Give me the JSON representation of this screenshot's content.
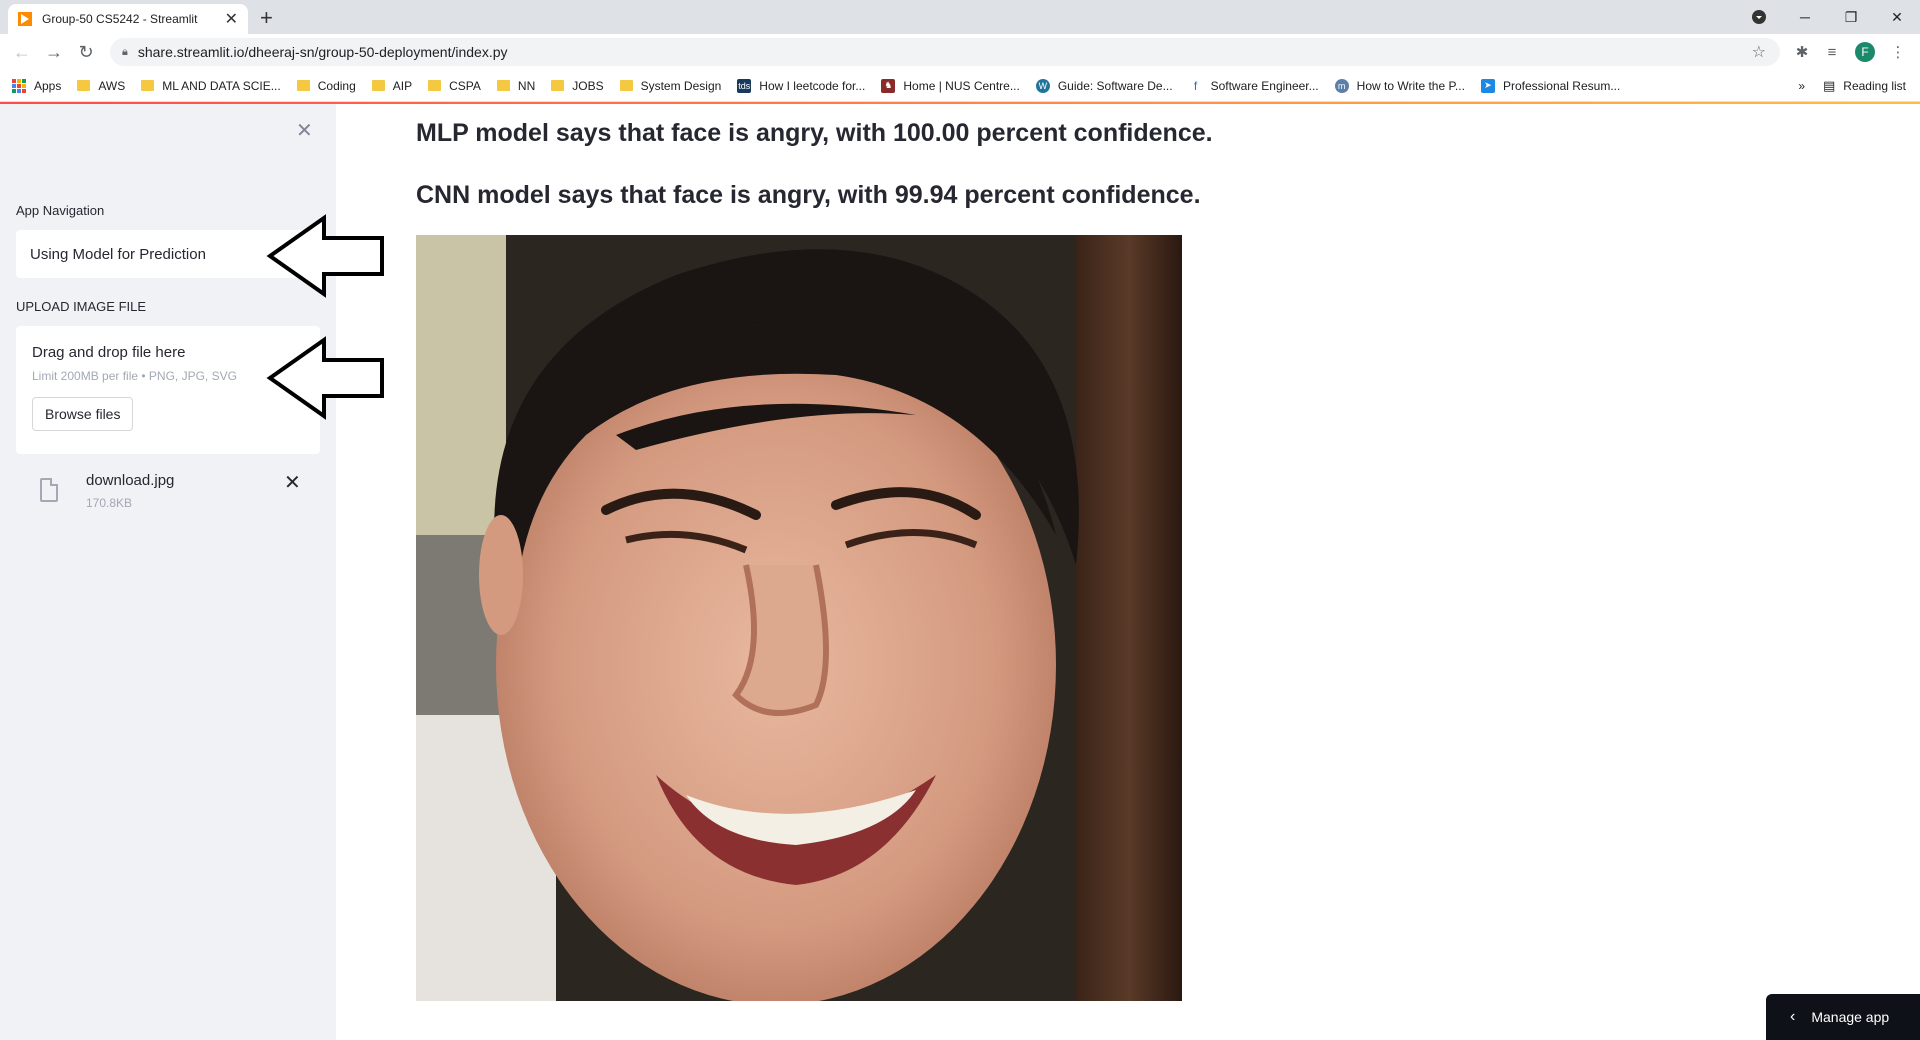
{
  "browser": {
    "tab_title": "Group-50 CS5242 - Streamlit",
    "tab_close": "✕",
    "new_tab": "+",
    "url": "share.streamlit.io/dheeraj-sn/group-50-deployment/index.py",
    "profile_initial": "F"
  },
  "bookmarks": {
    "items": [
      {
        "label": "Apps",
        "icon": "apps-grid-icon"
      },
      {
        "label": "AWS",
        "icon": "folder-icon"
      },
      {
        "label": "ML AND DATA SCIE...",
        "icon": "folder-icon"
      },
      {
        "label": "Coding",
        "icon": "folder-icon"
      },
      {
        "label": "AIP",
        "icon": "folder-icon"
      },
      {
        "label": "CSPA",
        "icon": "folder-icon"
      },
      {
        "label": "NN",
        "icon": "folder-icon"
      },
      {
        "label": "JOBS",
        "icon": "folder-icon"
      },
      {
        "label": "System Design",
        "icon": "folder-icon"
      },
      {
        "label": "How I leetcode for...",
        "icon": "site-icon"
      },
      {
        "label": "Home | NUS Centre...",
        "icon": "site-icon"
      },
      {
        "label": "Guide: Software De...",
        "icon": "wordpress-icon"
      },
      {
        "label": "Software Engineer...",
        "icon": "site-icon"
      },
      {
        "label": "How to Write the P...",
        "icon": "site-icon"
      },
      {
        "label": "Professional Resum...",
        "icon": "site-icon"
      }
    ],
    "overflow": "»",
    "reading_list": "Reading list"
  },
  "sidebar": {
    "nav_label": "App Navigation",
    "nav_selected": "Using Model for Prediction",
    "upload_label": "UPLOAD IMAGE FILE",
    "dropzone_title": "Drag and drop file here",
    "dropzone_limit": "Limit 200MB per file • PNG, JPG, SVG",
    "browse_label": "Browse files",
    "file_name": "download.jpg",
    "file_size": "170.8KB"
  },
  "main": {
    "mlp_result": "MLP model says that face is angry, with 100.00 percent confidence.",
    "cnn_result": "CNN model says that face is angry, with 99.94 percent confidence."
  },
  "manage_app": "Manage app",
  "colors": {
    "sidebar_bg": "#f0f2f6",
    "accent_red": "#ff4b4b",
    "manage_bg": "#0e1117"
  }
}
